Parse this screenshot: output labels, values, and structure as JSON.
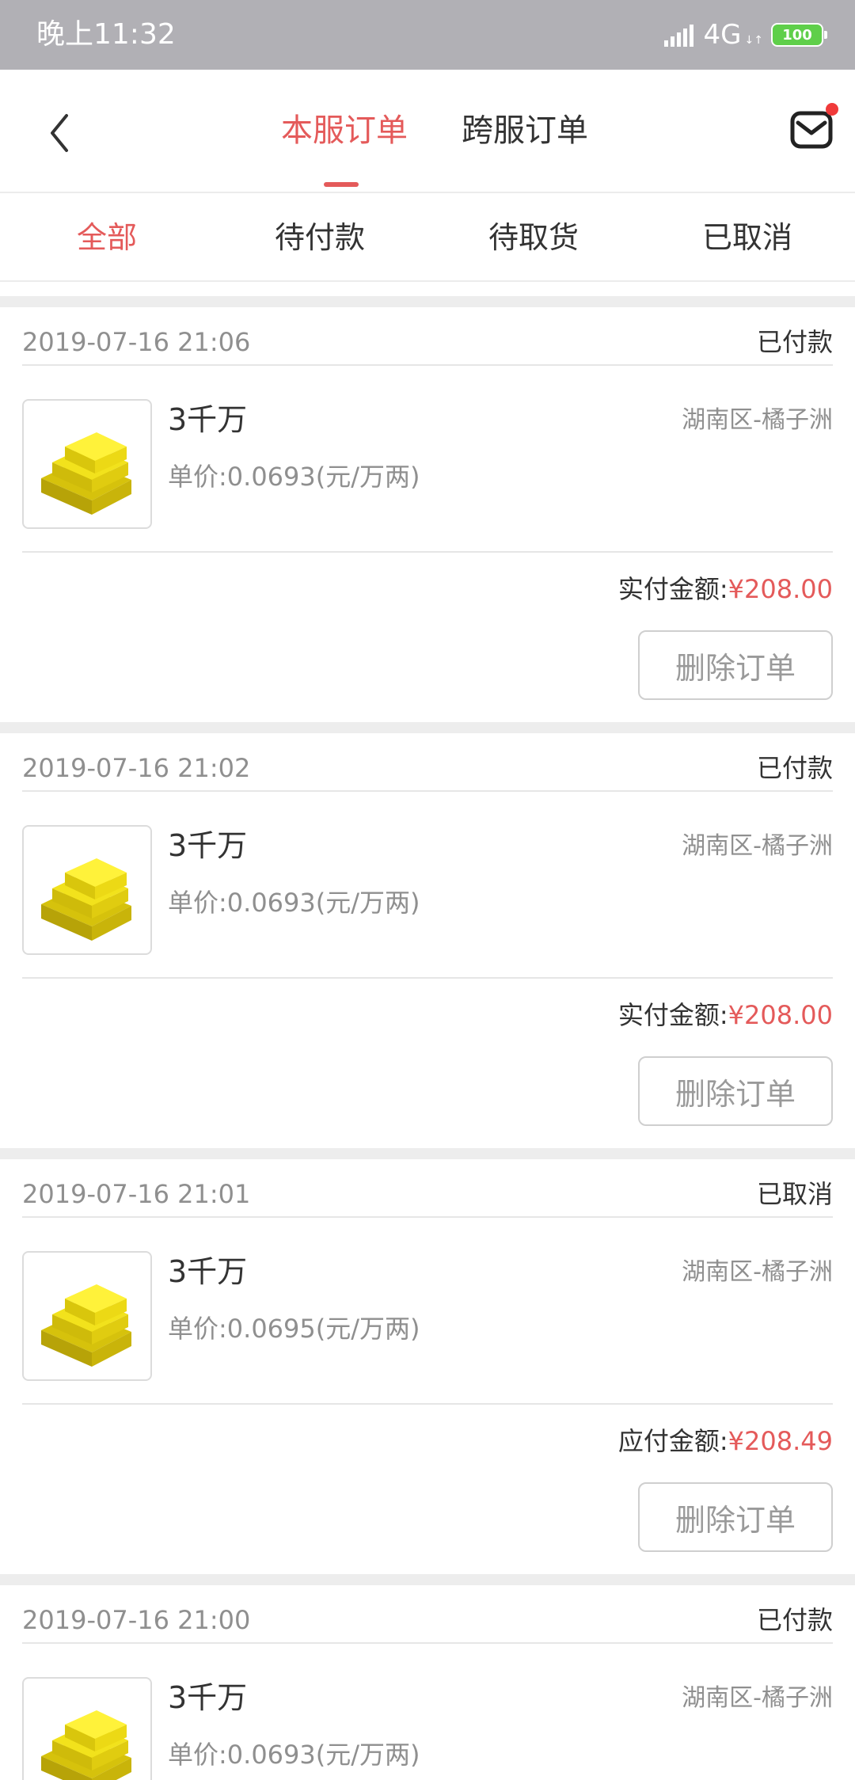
{
  "status_bar": {
    "time": "晚上11:32",
    "network": "4G",
    "network_arrows": "↓↑",
    "battery": "100"
  },
  "header": {
    "tabs": [
      {
        "label": "本服订单",
        "active": true
      },
      {
        "label": "跨服订单",
        "active": false
      }
    ],
    "icons": {
      "back": "chevron-left-icon",
      "mail": "mail-icon"
    }
  },
  "filters": [
    {
      "label": "全部",
      "active": true
    },
    {
      "label": "待付款",
      "active": false
    },
    {
      "label": "待取货",
      "active": false
    },
    {
      "label": "已取消",
      "active": false
    }
  ],
  "orders": [
    {
      "date": "2019-07-16 21:06",
      "status": "已付款",
      "product": "3千万",
      "region": "湖南区-橘子洲",
      "unit_price": "单价:0.0693(元/万两)",
      "amount_label": "实付金额:",
      "amount": "¥208.00",
      "delete_label": "删除订单"
    },
    {
      "date": "2019-07-16 21:02",
      "status": "已付款",
      "product": "3千万",
      "region": "湖南区-橘子洲",
      "unit_price": "单价:0.0693(元/万两)",
      "amount_label": "实付金额:",
      "amount": "¥208.00",
      "delete_label": "删除订单"
    },
    {
      "date": "2019-07-16 21:01",
      "status": "已取消",
      "product": "3千万",
      "region": "湖南区-橘子洲",
      "unit_price": "单价:0.0695(元/万两)",
      "amount_label": "应付金额:",
      "amount": "¥208.49",
      "delete_label": "删除订单"
    },
    {
      "date": "2019-07-16 21:00",
      "status": "已付款",
      "product": "3千万",
      "region": "湖南区-橘子洲",
      "unit_price": "单价:0.0693(元/万两)"
    }
  ],
  "colors": {
    "accent": "#e45a5a",
    "status_bar": "#b1b0b5",
    "muted_text": "#8f8f8f",
    "gold": "#f2e21c"
  }
}
